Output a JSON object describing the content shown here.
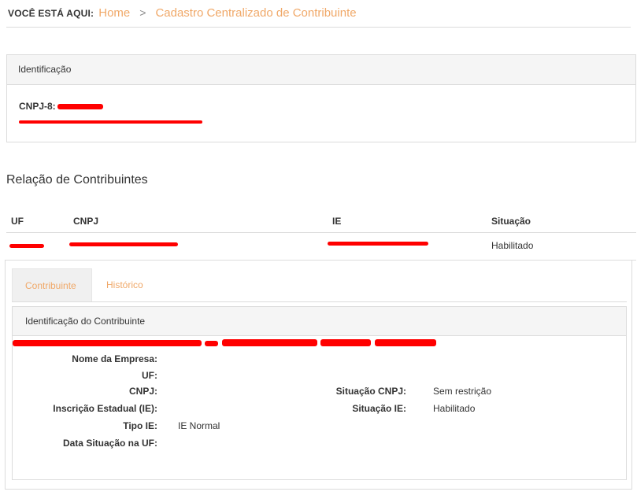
{
  "breadcrumb": {
    "prefix": "VOCÊ ESTÁ AQUI:",
    "home": "Home",
    "separator": ">",
    "current": "Cadastro Centralizado de Contribuinte"
  },
  "identification_panel": {
    "title": "Identificação",
    "cnpj_prefix": "CNPJ-8:"
  },
  "section_title": "Relação de Contribuintes",
  "table": {
    "headers": {
      "uf": "UF",
      "cnpj": "CNPJ",
      "ie": "IE",
      "situacao": "Situação"
    },
    "row": {
      "situacao": "Habilitado"
    }
  },
  "tabs": [
    {
      "label": "Contribuinte",
      "active": true
    },
    {
      "label": "Histórico",
      "active": false
    }
  ],
  "detail": {
    "title": "Identificação do Contribuinte",
    "labels": {
      "nome": "Nome da Empresa:",
      "uf": "UF:",
      "cnpj": "CNPJ:",
      "ie": "Inscrição Estadual (IE):",
      "tipo_ie": "Tipo IE:",
      "data_situacao": "Data Situação na UF:",
      "situacao_cnpj": "Situação CNPJ:",
      "situacao_ie": "Situação IE:"
    },
    "values": {
      "tipo_ie": "IE Normal",
      "situacao_cnpj": "Sem restrição",
      "situacao_ie": "Habilitado"
    }
  },
  "colors": {
    "accent": "#f0a868",
    "redaction": "#ff0000",
    "border": "#dcdcdc"
  }
}
